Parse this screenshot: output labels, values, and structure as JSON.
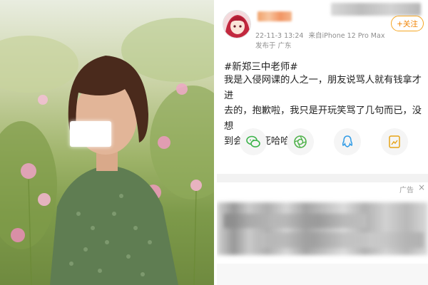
{
  "photo": {
    "description_icon": "portrait-photo",
    "face_blur_icon": "face-redaction-box"
  },
  "post": {
    "author": {
      "avatar_icon": "anime-avatar",
      "name_redacted_icon": "redacted-username"
    },
    "timestamp": "22-11-3 13:24",
    "source": "来自iPhone 12 Pro Max",
    "location": "发布于 广东",
    "follow_label": "+关注",
    "hashtag": "#新郑三中老师#",
    "content_lines": [
      "我是入侵网课的人之一，朋友说骂人就有钱拿才进",
      "去的，抱歉啦，我只是开玩笑骂了几句而已，没想",
      "到会有人死哈哈哈"
    ],
    "content_emoji_icon": "laughing-emoji",
    "share_icons": [
      "wechat-icon",
      "moments-icon",
      "qq-icon",
      "qzone-icon"
    ],
    "ad_label": "广告",
    "ad_close": "×",
    "colors": {
      "accent": "#f08200",
      "text": "#222222",
      "meta": "#8d8d8d"
    }
  }
}
